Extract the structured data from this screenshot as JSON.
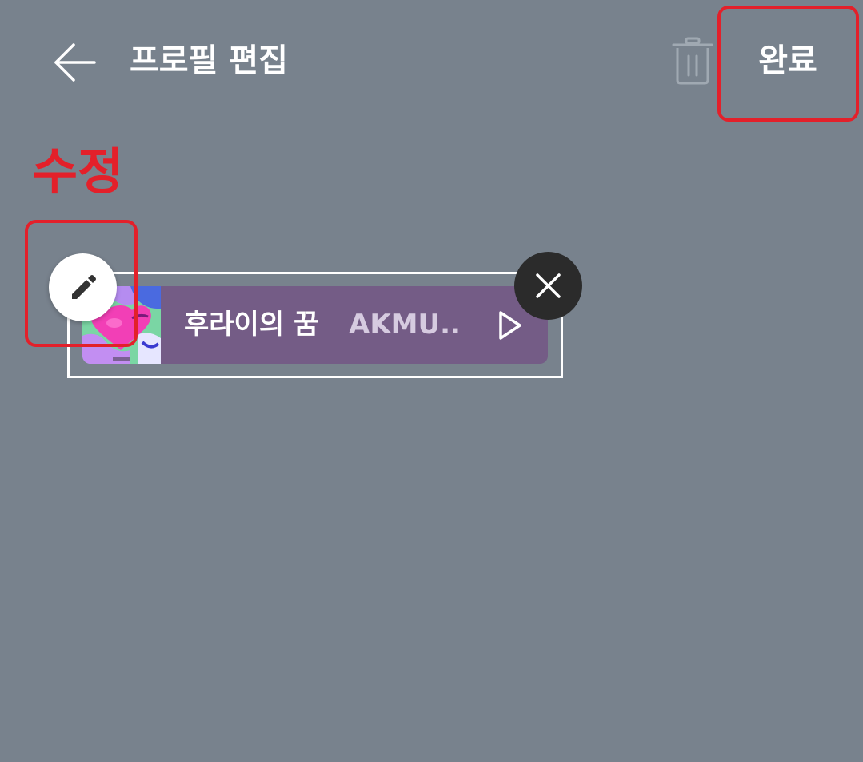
{
  "header": {
    "back_icon": "arrow-left-icon",
    "title": "프로필 편집",
    "trash_icon": "trash-icon",
    "done_label": "완료"
  },
  "annotation": {
    "label": "수정",
    "color": "#e3202a"
  },
  "music_widget": {
    "song_title": "후라이의 꿈",
    "artist": "AKMU..",
    "play_icon": "play-icon",
    "edit_icon": "pencil-icon",
    "remove_icon": "close-icon",
    "card_color": "#745c86"
  },
  "colors": {
    "background": "#78828d",
    "text": "#ffffff",
    "trash_disabled": "#a0a9b2"
  }
}
